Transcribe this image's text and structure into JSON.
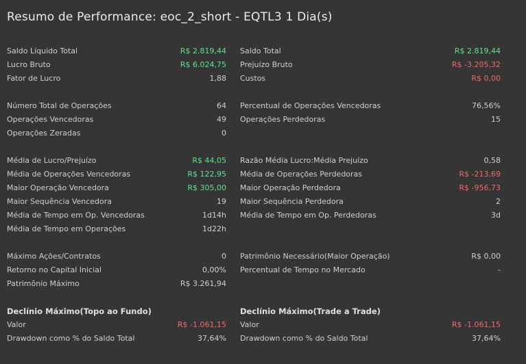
{
  "title": "Resumo de Performance: eoc_2_short - EQTL3 1 Dia(s)",
  "left": [
    {
      "label": "Saldo Líquido Total",
      "value": "R$ 2.819,44",
      "tone": "pos"
    },
    {
      "label": "Lucro Bruto",
      "value": "R$ 6.024,75",
      "tone": "pos"
    },
    {
      "label": "Fator de Lucro",
      "value": "1,88",
      "tone": ""
    },
    {
      "blank": true
    },
    {
      "label": "Número Total de Operações",
      "value": "64",
      "tone": ""
    },
    {
      "label": "Operações Vencedoras",
      "value": "49",
      "tone": ""
    },
    {
      "label": "Operações Zeradas",
      "value": "0",
      "tone": ""
    },
    {
      "blank": true
    },
    {
      "label": "Média de Lucro/Prejuízo",
      "value": "R$ 44,05",
      "tone": "pos"
    },
    {
      "label": "Média de Operações Vencedoras",
      "value": "R$ 122,95",
      "tone": "pos"
    },
    {
      "label": "Maior Operação Vencedora",
      "value": "R$ 305,00",
      "tone": "pos"
    },
    {
      "label": "Maior Sequência Vencedora",
      "value": "19",
      "tone": ""
    },
    {
      "label": "Média de Tempo em Op. Vencedoras",
      "value": "1d14h",
      "tone": ""
    },
    {
      "label": "Média de Tempo em Operações",
      "value": "1d22h",
      "tone": ""
    },
    {
      "blank": true
    },
    {
      "label": "Máximo Ações/Contratos",
      "value": "0",
      "tone": ""
    },
    {
      "label": "Retorno no Capital Inicial",
      "value": "0,00%",
      "tone": ""
    },
    {
      "label": "Patrimônio Máximo",
      "value": "R$ 3.261,94",
      "tone": ""
    },
    {
      "blank": true
    },
    {
      "heading": "Declínio Máximo(Topo ao Fundo)"
    },
    {
      "label": "Valor",
      "value": "R$ -1.061,15",
      "tone": "neg"
    },
    {
      "label": "Drawdown como % do Saldo Total",
      "value": "37,64%",
      "tone": ""
    }
  ],
  "right": [
    {
      "label": "Saldo Total",
      "value": "R$ 2.819,44",
      "tone": "pos"
    },
    {
      "label": "Prejuízo Bruto",
      "value": "R$ -3.205,32",
      "tone": "neg"
    },
    {
      "label": "Custos",
      "value": "R$ 0,00",
      "tone": "neg"
    },
    {
      "blank": true
    },
    {
      "label": "Percentual de Operações Vencedoras",
      "value": "76,56%",
      "tone": ""
    },
    {
      "label": "Operações Perdedoras",
      "value": "15",
      "tone": ""
    },
    {
      "blank": true
    },
    {
      "blank": true
    },
    {
      "label": "Razão Média Lucro:Média Prejuízo",
      "value": "0,58",
      "tone": ""
    },
    {
      "label": "Média de Operações Perdedoras",
      "value": "R$ -213,69",
      "tone": "neg"
    },
    {
      "label": "Maior Operação Perdedora",
      "value": "R$ -956,73",
      "tone": "neg"
    },
    {
      "label": "Maior Sequência Perdedora",
      "value": "2",
      "tone": ""
    },
    {
      "label": "Média de Tempo em Op. Perdedoras",
      "value": "3d",
      "tone": ""
    },
    {
      "blank": true
    },
    {
      "blank": true
    },
    {
      "label": "Patrimônio Necessário(Maior Operação)",
      "value": "R$ 0,00",
      "tone": ""
    },
    {
      "label": "Percentual de Tempo no Mercado",
      "value": "-",
      "tone": ""
    },
    {
      "blank": true
    },
    {
      "blank": true
    },
    {
      "heading": "Declínio Máximo(Trade a Trade)"
    },
    {
      "label": "Valor",
      "value": "R$ -1.061,15",
      "tone": "neg"
    },
    {
      "label": "Drawdown como % do Saldo Total",
      "value": "37,64%",
      "tone": ""
    }
  ],
  "colors": {
    "background": "#353535",
    "positive": "#5fe38f",
    "negative": "#f06a6a"
  }
}
